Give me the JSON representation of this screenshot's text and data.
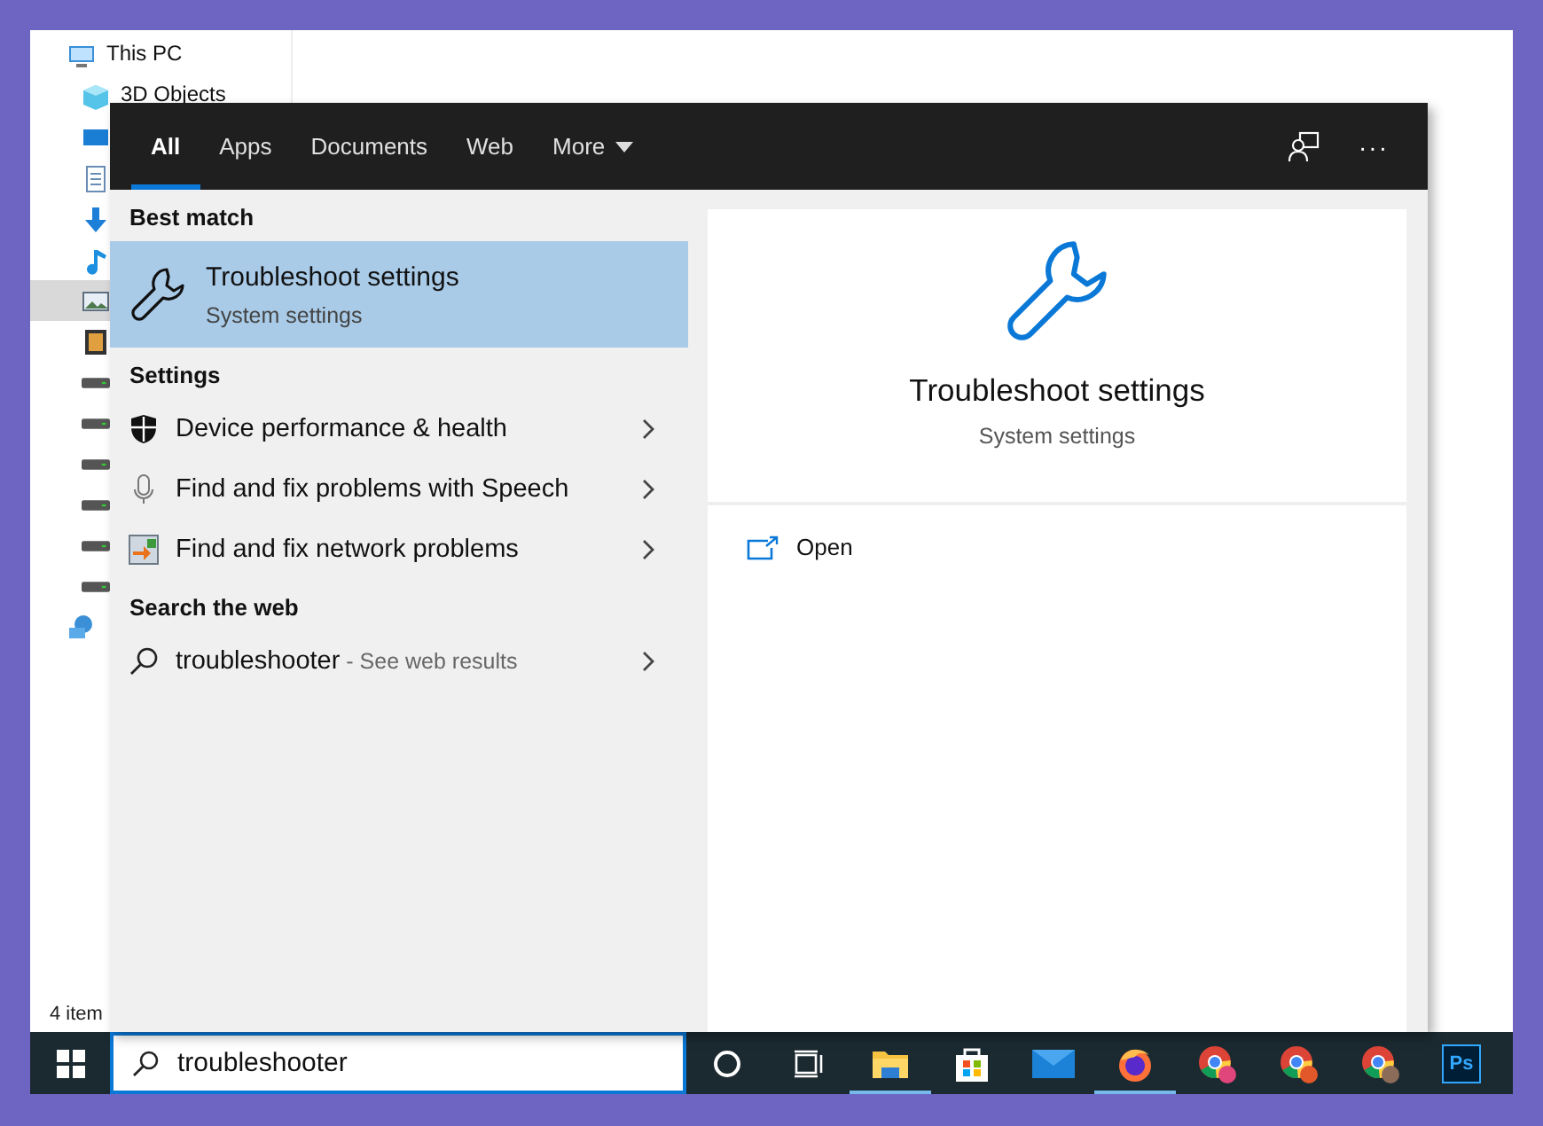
{
  "explorer": {
    "tree": [
      {
        "label": "This PC",
        "kind": "pc",
        "selected": false,
        "children": [
          {
            "label": "3D Objects",
            "kind": "cube",
            "selected": false
          },
          {
            "kind": "desktop",
            "selected": false
          },
          {
            "kind": "document",
            "selected": false
          },
          {
            "kind": "download",
            "selected": false
          },
          {
            "kind": "music",
            "selected": false
          },
          {
            "kind": "picture",
            "selected": true
          },
          {
            "kind": "video",
            "selected": false
          },
          {
            "kind": "drive",
            "selected": false
          },
          {
            "kind": "drive",
            "selected": false
          },
          {
            "kind": "drive",
            "selected": false
          },
          {
            "kind": "drive",
            "selected": false
          },
          {
            "kind": "drive",
            "selected": false
          },
          {
            "kind": "drive",
            "selected": false
          }
        ]
      },
      {
        "kind": "network",
        "selected": false
      }
    ],
    "status": "4 item"
  },
  "search": {
    "tabs": [
      {
        "label": "All",
        "selected": true,
        "kind": "tab"
      },
      {
        "label": "Apps",
        "selected": false,
        "kind": "tab"
      },
      {
        "label": "Documents",
        "selected": false,
        "kind": "tab"
      },
      {
        "label": "Web",
        "selected": false,
        "kind": "tab"
      },
      {
        "label": "More",
        "selected": false,
        "kind": "dropdown"
      }
    ],
    "more_button": "···",
    "best_match": {
      "heading": "Best match",
      "title": "Troubleshoot settings",
      "subtitle": "System settings",
      "selected": true
    },
    "settings": {
      "heading": "Settings",
      "items": [
        {
          "label": "Device performance & health",
          "kind": "shield"
        },
        {
          "label": "Find and fix problems with Speech",
          "kind": "mic"
        },
        {
          "label": "Find and fix network problems",
          "kind": "network"
        }
      ]
    },
    "web": {
      "heading": "Search the web",
      "query": "troubleshooter",
      "hint": " - See web results"
    },
    "preview": {
      "title": "Troubleshoot settings",
      "subtitle": "System settings",
      "actions": [
        {
          "label": "Open"
        }
      ]
    }
  },
  "taskbar": {
    "search_value": "troubleshooter",
    "apps": [
      {
        "kind": "cortana",
        "running": false
      },
      {
        "kind": "taskview",
        "running": false
      },
      {
        "kind": "explorer",
        "running": true
      },
      {
        "kind": "store",
        "running": false
      },
      {
        "kind": "mail",
        "running": false
      },
      {
        "kind": "firefox",
        "running": true
      },
      {
        "kind": "chrome",
        "running": false,
        "color": "#e0457b"
      },
      {
        "kind": "chrome",
        "running": false,
        "color": "#e2582a"
      },
      {
        "kind": "chrome",
        "running": false,
        "color": "#8a6c58"
      },
      {
        "kind": "photoshop",
        "running": false,
        "label": "Ps"
      }
    ]
  }
}
